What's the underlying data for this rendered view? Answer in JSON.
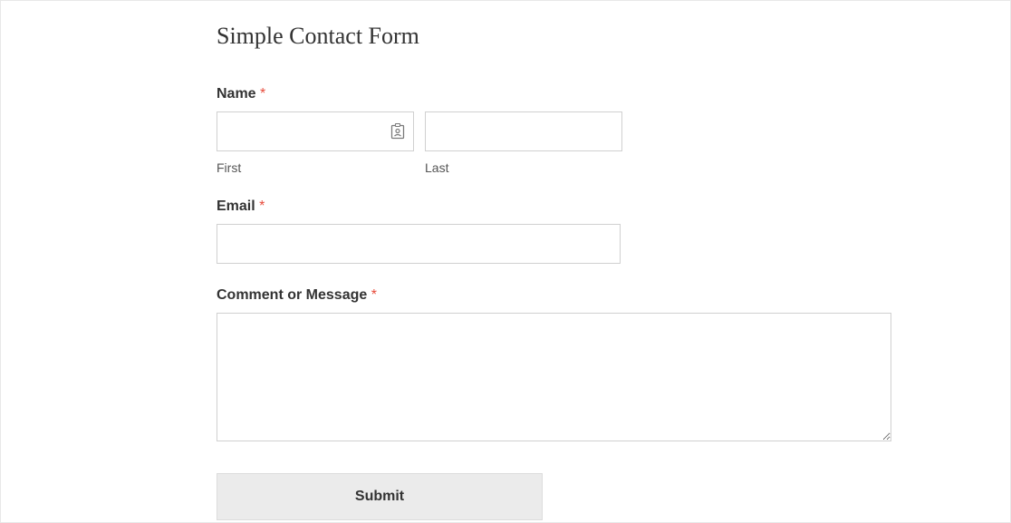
{
  "form": {
    "title": "Simple Contact Form",
    "required_mark": "*",
    "name": {
      "label": "Name",
      "first_sublabel": "First",
      "last_sublabel": "Last",
      "first_value": "",
      "last_value": ""
    },
    "email": {
      "label": "Email",
      "value": ""
    },
    "message": {
      "label": "Comment or Message",
      "value": ""
    },
    "submit_label": "Submit"
  }
}
